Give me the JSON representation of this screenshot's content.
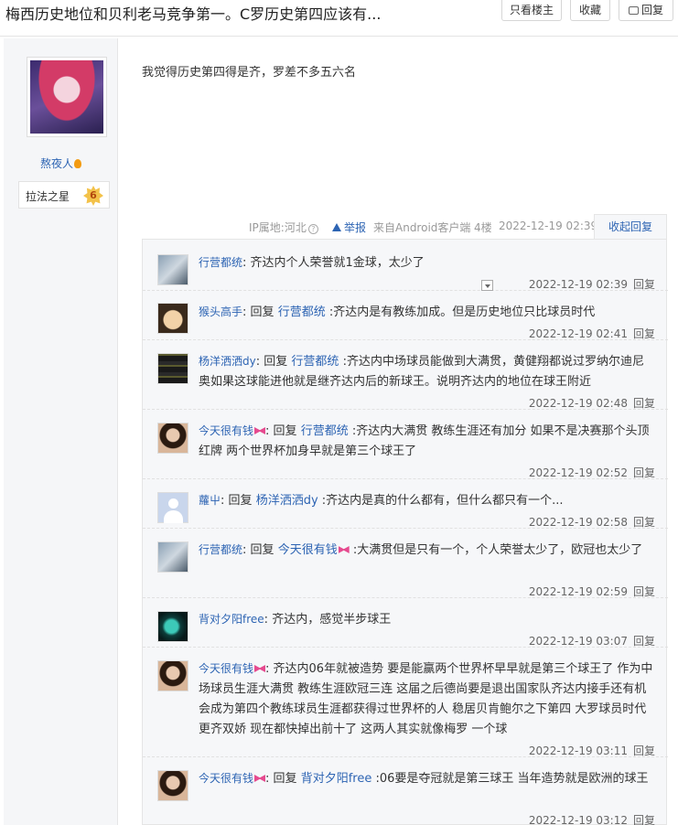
{
  "header": {
    "title": "梅西历史地位和贝利老马竞争第一。C罗历史第四应该有...",
    "only_op_label": "只看楼主",
    "favorite_label": "收藏",
    "reply_label": "回复"
  },
  "author": {
    "name": "熬夜人",
    "badge_label": "拉法之星",
    "badge_level": "6"
  },
  "post": {
    "content": "我觉得历史第四得是齐，罗差不多五六名",
    "ip_location": "IP属地:河北",
    "report_label": "举报",
    "client": "来自Android客户端",
    "floor": "4楼",
    "time": "2022-12-19 02:39",
    "collapse_label": "收起回复"
  },
  "replies": [
    {
      "user": "行营都统",
      "reply_to": "",
      "text": "齐达内个人荣誉就1金球，太少了",
      "time": "2022-12-19 02:39",
      "action": "回复"
    },
    {
      "user": "猴头高手",
      "reply_to": "行营都统",
      "text": ":齐达内是有教练加成。但是历史地位只比球员时代",
      "time": "2022-12-19 02:41",
      "action": "回复"
    },
    {
      "user": "杨洋洒洒dy",
      "reply_to": "行营都统",
      "text": ":齐达内中场球员能做到大满贯，黄健翔都说过罗纳尔迪尼奥如果这球能进他就是继齐达内后的新球王。说明齐达内的地位在球王附近",
      "time": "2022-12-19 02:48",
      "action": "回复"
    },
    {
      "user": "今天很有钱",
      "reply_to": "行营都统",
      "text": ":齐达内大满贯 教练生涯还有加分 如果不是决赛那个头顶红牌 两个世界杯加身早就是第三个球王了",
      "time": "2022-12-19 02:52",
      "action": "回复"
    },
    {
      "user": "蘿屮",
      "reply_to": "杨洋洒洒dy",
      "text": ":齐达内是真的什么都有，但什么都只有一个...",
      "time": "2022-12-19 02:58",
      "action": "回复"
    },
    {
      "user": "行营都统",
      "reply_to": "今天很有钱",
      "text": ":大满贯但是只有一个，个人荣誉太少了，欧冠也太少了",
      "time": "2022-12-19 02:59",
      "action": "回复"
    },
    {
      "user": "背对夕阳free",
      "reply_to": "",
      "text": "齐达内，感觉半步球王",
      "time": "2022-12-19 03:07",
      "action": "回复"
    },
    {
      "user": "今天很有钱",
      "reply_to": "",
      "text": "齐达内06年就被造势 要是能赢两个世界杯早早就是第三个球王了 作为中场球员生涯大满贯 教练生涯欧冠三连 这届之后德尚要是退出国家队齐达内接手还有机会成为第四个教练球员生涯都获得过世界杯的人 稳居贝肯鲍尔之下第四 大罗球员时代更齐双娇 现在都快掉出前十了 这两人其实就像梅罗 一个球",
      "time": "2022-12-19 03:11",
      "action": "回复"
    },
    {
      "user": "今天很有钱",
      "reply_to": "背对夕阳free",
      "text": ":06要是夺冠就是第三球王 当年造势就是欧洲的球王",
      "time": "2022-12-19 03:12",
      "action": "回复"
    }
  ],
  "reply_word": "回复"
}
